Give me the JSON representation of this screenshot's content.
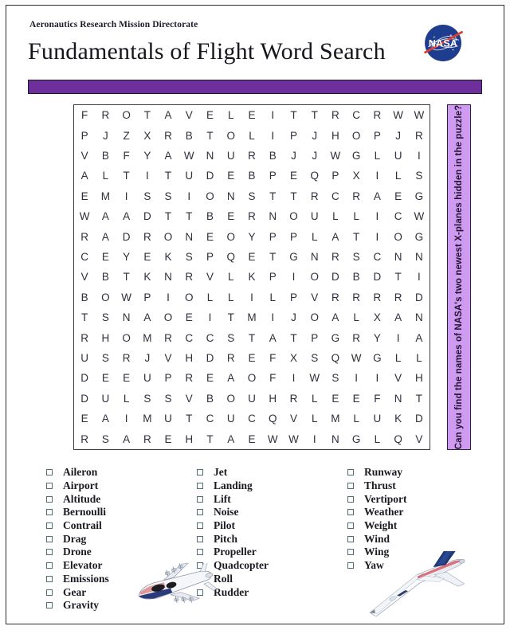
{
  "header": {
    "kicker": "Aeronautics Research Mission Directorate",
    "title": "Fundamentals of Flight Word Search",
    "logo_icon": "nasa-meatball-logo",
    "logo_text": "NASA"
  },
  "banner": {
    "color": "#6d2f9c"
  },
  "side_note": {
    "text": "Can you find the names of NASA's two newest X-planes hidden in the puzzle?",
    "background": "#cf9bf0",
    "border": "#2e2040"
  },
  "puzzle": {
    "rows": 16,
    "cols": 16,
    "grid": [
      [
        "F",
        "R",
        "O",
        "T",
        "A",
        "V",
        "E",
        "L",
        "E",
        "I",
        "T",
        "T",
        "R",
        "C",
        "R",
        "W",
        "W"
      ],
      [
        "P",
        "J",
        "Z",
        "X",
        "R",
        "B",
        "T",
        "O",
        "L",
        "I",
        "P",
        "J",
        "H",
        "O",
        "P",
        "J",
        "R"
      ],
      [
        "V",
        "B",
        "F",
        "Y",
        "A",
        "W",
        "N",
        "U",
        "R",
        "B",
        "J",
        "J",
        "W",
        "G",
        "L",
        "U",
        "I"
      ],
      [
        "A",
        "L",
        "T",
        "I",
        "T",
        "U",
        "D",
        "E",
        "B",
        "P",
        "E",
        "Q",
        "P",
        "X",
        "I",
        "L",
        "S"
      ],
      [
        "E",
        "M",
        "I",
        "S",
        "S",
        "I",
        "O",
        "N",
        "S",
        "T",
        "T",
        "R",
        "C",
        "R",
        "A",
        "E",
        "G"
      ],
      [
        "W",
        "A",
        "A",
        "D",
        "T",
        "T",
        "B",
        "E",
        "R",
        "N",
        "O",
        "U",
        "L",
        "L",
        "I",
        "C",
        "W"
      ],
      [
        "R",
        "A",
        "D",
        "R",
        "O",
        "N",
        "E",
        "O",
        "Y",
        "P",
        "P",
        "L",
        "A",
        "T",
        "I",
        "O",
        "G"
      ],
      [
        "C",
        "E",
        "Y",
        "E",
        "K",
        "S",
        "P",
        "Q",
        "E",
        "T",
        "G",
        "N",
        "R",
        "S",
        "C",
        "N",
        "N"
      ],
      [
        "V",
        "B",
        "T",
        "K",
        "N",
        "R",
        "V",
        "L",
        "K",
        "P",
        "I",
        "O",
        "D",
        "B",
        "D",
        "T",
        "I"
      ],
      [
        "B",
        "O",
        "W",
        "P",
        "I",
        "O",
        "L",
        "L",
        "I",
        "L",
        "P",
        "V",
        "R",
        "R",
        "R",
        "R",
        "D"
      ],
      [
        "T",
        "S",
        "N",
        "A",
        "O",
        "E",
        "I",
        "T",
        "M",
        "I",
        "J",
        "O",
        "A",
        "L",
        "X",
        "A",
        "N"
      ],
      [
        "R",
        "H",
        "O",
        "M",
        "R",
        "C",
        "C",
        "S",
        "T",
        "A",
        "T",
        "P",
        "G",
        "R",
        "Y",
        "I",
        "A"
      ],
      [
        "U",
        "S",
        "R",
        "J",
        "V",
        "H",
        "D",
        "R",
        "E",
        "F",
        "X",
        "S",
        "Q",
        "W",
        "G",
        "L",
        "L"
      ],
      [
        "D",
        "E",
        "E",
        "U",
        "P",
        "R",
        "E",
        "A",
        "O",
        "F",
        "I",
        "W",
        "S",
        "I",
        "I",
        "V",
        "H"
      ],
      [
        "D",
        "U",
        "L",
        "S",
        "S",
        "V",
        "B",
        "O",
        "U",
        "H",
        "R",
        "L",
        "E",
        "E",
        "F",
        "N",
        "T"
      ],
      [
        "E",
        "A",
        "I",
        "M",
        "U",
        "T",
        "C",
        "U",
        "C",
        "Q",
        "V",
        "L",
        "M",
        "L",
        "U",
        "K",
        "D"
      ],
      [
        "R",
        "S",
        "A",
        "R",
        "E",
        "H",
        "T",
        "A",
        "E",
        "W",
        "W",
        "I",
        "N",
        "G",
        "L",
        "Q",
        "V"
      ]
    ]
  },
  "wordlist": {
    "columns": [
      {
        "items": [
          "Aileron",
          "Airport",
          "Altitude",
          "Bernoulli",
          "Contrail",
          "Drag",
          "Drone",
          "Elevator",
          "Emissions",
          "Gear",
          "Gravity"
        ]
      },
      {
        "items": [
          "Jet",
          "Landing",
          "Lift",
          "Noise",
          "Pilot",
          "Pitch",
          "Propeller",
          "Quadcopter",
          "Roll",
          "Rudder"
        ]
      },
      {
        "items": [
          "Runway",
          "Thrust",
          "Vertiport",
          "Weather",
          "Weight",
          "Wind",
          "Wing",
          "Yaw"
        ]
      }
    ]
  },
  "illustrations": {
    "left": "electric-propeller-aircraft-illustration",
    "right": "supersonic-x-plane-illustration"
  }
}
